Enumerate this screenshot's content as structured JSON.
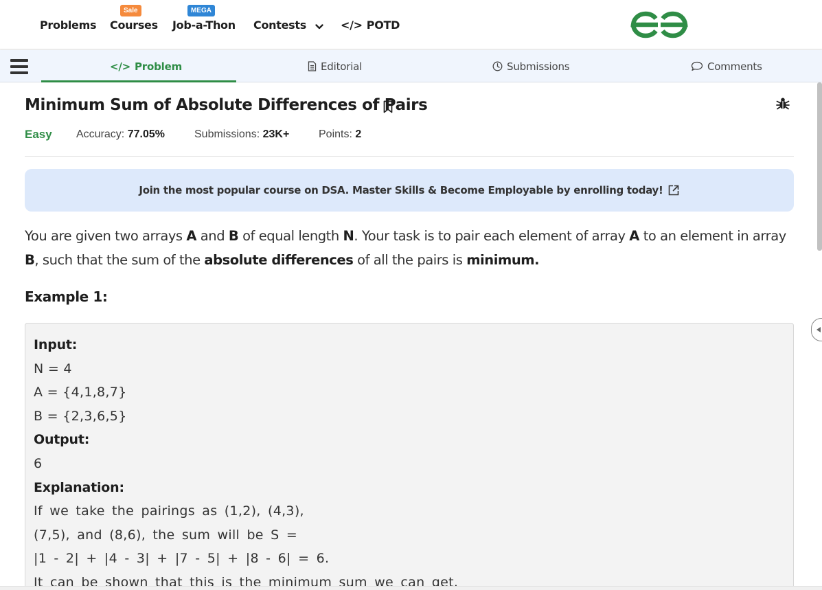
{
  "nav": {
    "problems": "Problems",
    "courses": "Courses",
    "courses_badge": "Sale",
    "jobathon": "Job-a-Thon",
    "jobathon_badge": "MEGA",
    "contests": "Contests",
    "potd": "POTD",
    "potd_icon_text": "</>"
  },
  "tabs": {
    "problem": "Problem",
    "problem_icon_text": "</>",
    "editorial": "Editorial",
    "submissions": "Submissions",
    "comments": "Comments"
  },
  "problem": {
    "title": "Minimum Sum of Absolute Differences of Pairs",
    "difficulty": "Easy",
    "accuracy_label": "Accuracy:",
    "accuracy_value": "77.05%",
    "submissions_label": "Submissions:",
    "submissions_value": "23K+",
    "points_label": "Points:",
    "points_value": "2"
  },
  "banner": {
    "text": "Join the most popular course on DSA. Master Skills & Become Employable by enrolling today!"
  },
  "statement": {
    "t1": "You are given two arrays ",
    "b1": "A",
    "t2": " and ",
    "b2": "B",
    "t3": " of equal length ",
    "b3": "N",
    "t4": ". Your task is to pair each element of array ",
    "b4": "A",
    "t5": " to an element in array ",
    "b5": "B",
    "t6": ", such that the sum of the ",
    "b6": "absolute differences",
    "t7": " of all the pairs is ",
    "b7": "minimum."
  },
  "example": {
    "title": "Example 1:",
    "lines": [
      "Input:",
      "N = 4",
      "A = {4,1,8,7}",
      "B = {2,3,6,5}",
      "Output:",
      "6",
      "Explanation:",
      "If we take the pairings as (1,2), (4,3),",
      "(7,5), and (8,6), the sum will be S =",
      "|1 - 2| + |4 - 3| + |7 - 5| + |8 - 6| = 6.",
      "It can be shown that this is the minimum sum we can get."
    ]
  },
  "colors": {
    "brand_green": "#2f8d46",
    "banner_bg": "#dde9fb",
    "tabbar_bg": "#f0f5fd",
    "sale_badge": "#f58a3c",
    "mega_badge": "#2f86d6"
  },
  "icons": [
    "chevron-down-icon",
    "code-icon",
    "gfg-logo",
    "menu-icon",
    "editorial-icon",
    "clock-icon",
    "comment-icon",
    "bookmark-icon",
    "bug-icon",
    "external-link-icon",
    "collapse-panel-icon"
  ]
}
